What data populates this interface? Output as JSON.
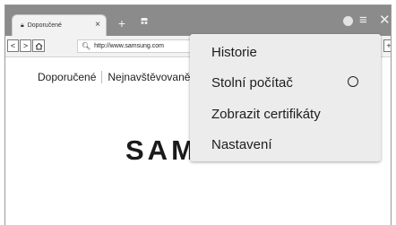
{
  "tab": {
    "title": "Doporučené"
  },
  "toolbar": {
    "url": "http://www.samsung.com"
  },
  "page": {
    "subnav": [
      "Doporučené",
      "Nejnavštěvovaně"
    ],
    "logo": "SAM"
  },
  "menu": {
    "items": [
      {
        "label": "Historie"
      },
      {
        "label": "Stolní počítač"
      },
      {
        "label": "Zobrazit certifikáty"
      },
      {
        "label": "Nastavení"
      }
    ]
  }
}
